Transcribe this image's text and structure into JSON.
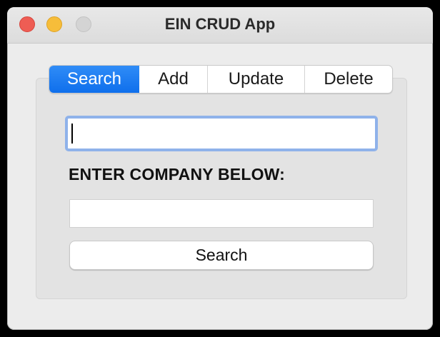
{
  "window": {
    "title": "EIN CRUD App"
  },
  "titlebar": {
    "buttons": [
      "close",
      "minimize",
      "zoom"
    ]
  },
  "tabs": [
    {
      "label": "Search",
      "active": true
    },
    {
      "label": "Add",
      "active": false
    },
    {
      "label": "Update",
      "active": false
    },
    {
      "label": "Delete",
      "active": false
    }
  ],
  "form": {
    "ein_input_value": "",
    "company_label": "ENTER COMPANY BELOW:",
    "company_input_value": "",
    "search_button_label": "Search"
  },
  "colors": {
    "accent": "#0f6fec",
    "focus_ring": "#8fb2ea",
    "close": "#ee5d54",
    "minimize": "#f6bd3a",
    "zoom_inactive": "#d4d4d4"
  }
}
